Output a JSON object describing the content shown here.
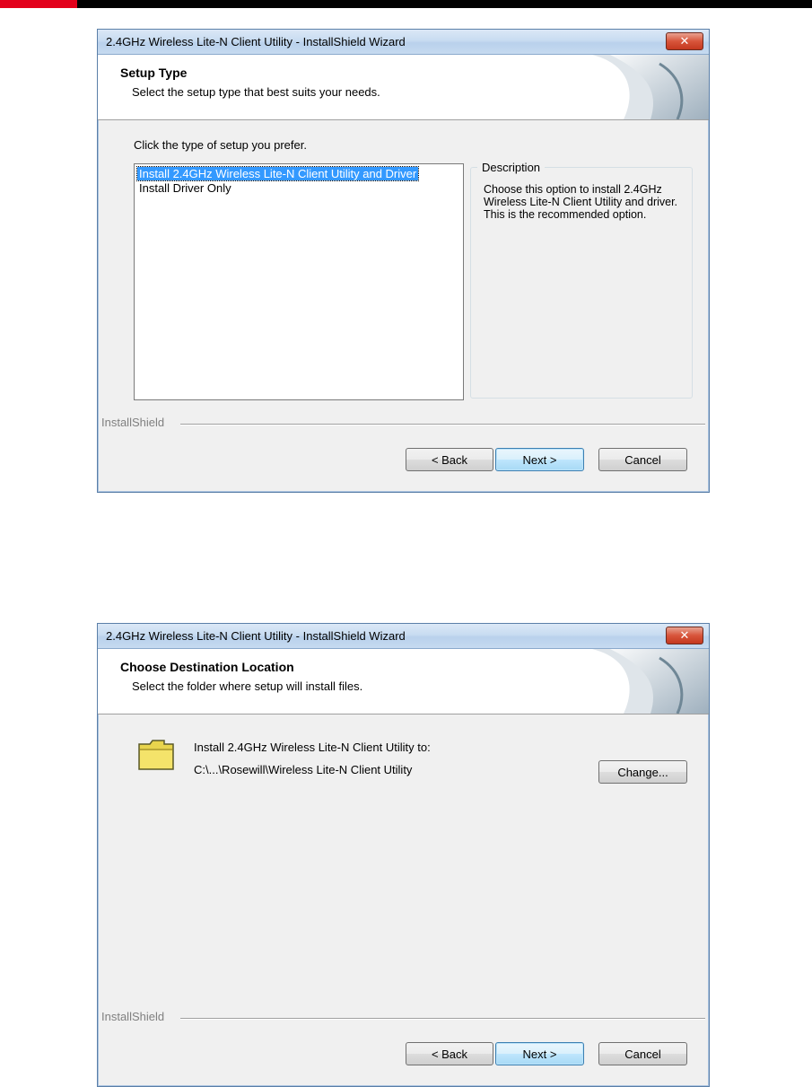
{
  "dialogs": [
    {
      "title": "2.4GHz Wireless Lite-N Client Utility - InstallShield Wizard",
      "close_glyph": "✕",
      "header_title": "Setup Type",
      "header_subtitle": "Select the setup type that best suits your needs.",
      "prompt": "Click the type of setup you prefer.",
      "options": [
        {
          "label": "Install 2.4GHz Wireless Lite-N Client Utility and Driver",
          "selected": true
        },
        {
          "label": "Install Driver Only",
          "selected": false
        }
      ],
      "description_label": "Description",
      "description_text": "Choose this option to install 2.4GHz Wireless Lite-N Client Utility and driver. This is the recommended option.",
      "brand": "InstallShield",
      "buttons": {
        "back": "< Back",
        "next": "Next >",
        "cancel": "Cancel"
      }
    },
    {
      "title": "2.4GHz Wireless Lite-N Client Utility - InstallShield Wizard",
      "close_glyph": "✕",
      "header_title": "Choose Destination Location",
      "header_subtitle": "Select the folder where setup will install files.",
      "install_label": "Install 2.4GHz Wireless Lite-N Client Utility to:",
      "install_path": "C:\\...\\Rosewill\\Wireless Lite-N Client Utility",
      "change_button": "Change...",
      "brand": "InstallShield",
      "buttons": {
        "back": "< Back",
        "next": "Next >",
        "cancel": "Cancel"
      }
    }
  ],
  "colors": {
    "selection": "#3399ff",
    "accent_red": "#e3001b",
    "title_bar": "#c8dcf1"
  },
  "icons": {
    "close": "close-icon",
    "folder": "folder-icon",
    "header_art": "page-curl-icon"
  }
}
